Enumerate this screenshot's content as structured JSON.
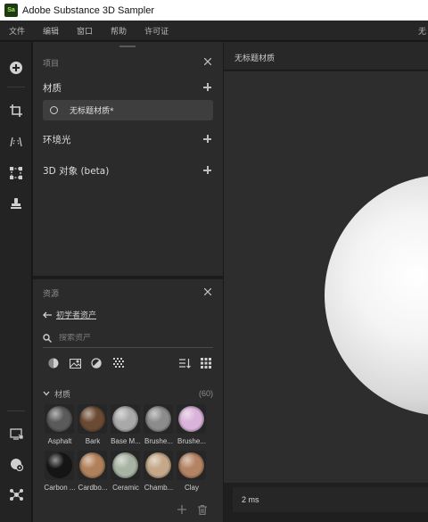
{
  "window": {
    "logo_text": "Sa",
    "title": "Adobe Substance 3D Sampler"
  },
  "menubar": {
    "items": [
      "文件",
      "编辑",
      "窗口",
      "帮助",
      "许可证"
    ],
    "right_text": "无"
  },
  "toolbar": {
    "icons": [
      "add-circle-icon",
      "crop-icon",
      "perspective-icon",
      "tiling-icon",
      "stamp-icon",
      "export-screen-icon",
      "material-settings-icon",
      "molecule-icon"
    ]
  },
  "project_panel": {
    "title": "项目",
    "sections": {
      "materials": "材质",
      "environment": "环境光",
      "objects": "3D 对象 (beta)"
    },
    "material_item": "无标题材质*"
  },
  "assets_panel": {
    "title": "资源",
    "back_label": "初学者资产",
    "search_placeholder": "搜索资产",
    "category_label": "材质",
    "category_count": "(60)",
    "materials": [
      {
        "name": "Asphalt",
        "color": "#5a5a5a"
      },
      {
        "name": "Bark",
        "color": "#6b4a33"
      },
      {
        "name": "Base M...",
        "color": "#a9a9a9"
      },
      {
        "name": "Brushe...",
        "color": "#8c8c8c"
      },
      {
        "name": "Brushe...",
        "color": "#d9b3d9"
      },
      {
        "name": "Carbon ...",
        "color": "#151515"
      },
      {
        "name": "Cardbo...",
        "color": "#b0805a"
      },
      {
        "name": "Ceramic",
        "color": "#a8b3a3"
      },
      {
        "name": "Chamb...",
        "color": "#c4a889"
      },
      {
        "name": "Clay",
        "color": "#b38363"
      }
    ]
  },
  "viewport": {
    "tab_label": "无标题材质",
    "status_text": "2 ms"
  }
}
